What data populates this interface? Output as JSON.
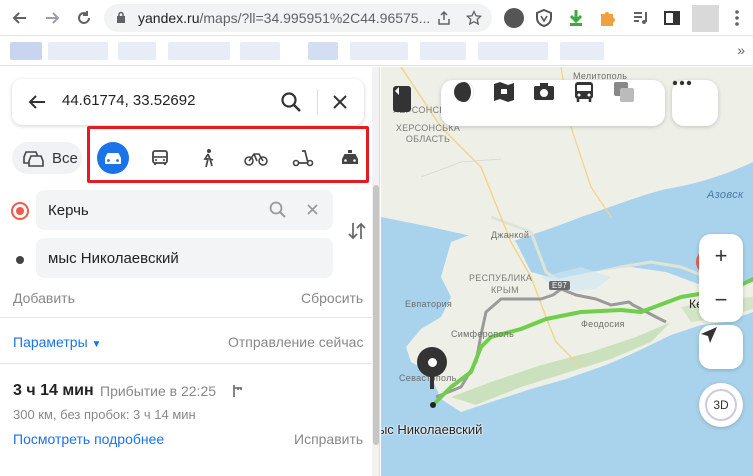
{
  "browser": {
    "url_host": "yandex.ru",
    "url_path": "/maps/?ll=34.995951%2C44.96575..."
  },
  "search": {
    "value": "44.61774, 33.52692"
  },
  "modes": {
    "all_label": "Все",
    "items": [
      "car-icon",
      "bus-icon",
      "walk-icon",
      "bicycle-icon",
      "scooter-icon",
      "taxi-icon"
    ],
    "active": "car-icon"
  },
  "route": {
    "from": "Керчь",
    "to": "мыс Николаевский",
    "add_label": "Добавить",
    "reset_label": "Сбросить",
    "params_label": "Параметры",
    "departure_label": "Отправление сейчас",
    "duration": "3 ч 14 мин",
    "arrival": "Прибытие в 22:25",
    "distance": "300 км, без пробок: 3 ч 14 мин",
    "details_label": "Посмотреть подробнее",
    "fix_label": "Исправить"
  },
  "map": {
    "labels": {
      "melitopol": "Мелитополь",
      "kherson_region": "ХЕРСОНСКАЯ ОБЛАСТЬ",
      "kherson_region_2": "ХЕРСОНСЬКА ОБЛАСТЬ",
      "azov": "Азовск",
      "dzhankoy": "Джанкой",
      "republic": "РЕСПУБЛИКА",
      "crimea": "КРЫМ",
      "evpatoria": "Евпатория",
      "simferopol": "Симферополь",
      "feodosia": "Феодосия",
      "sevastopol": "Севастополь",
      "kerch": "Керч",
      "road": "Е97"
    },
    "destination_label": "мыс Николаевский",
    "zoom_in": "+",
    "zoom_out": "−",
    "btn_3d": "3D",
    "colors": {
      "route": "#6fcf4a",
      "route_alt": "#9a9a9a",
      "sea": "#a9d3ec",
      "land": "#eef0e8"
    }
  }
}
